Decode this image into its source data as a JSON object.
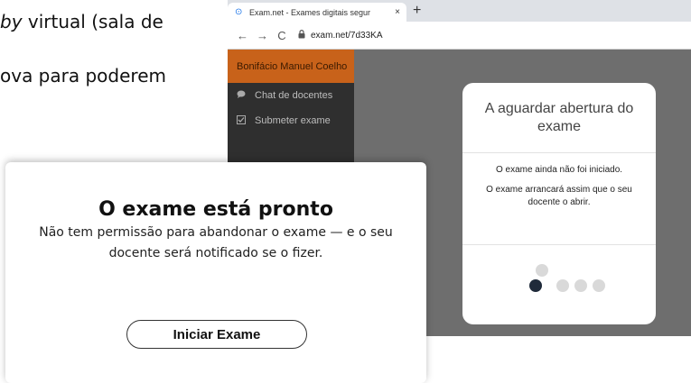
{
  "document": {
    "line1_italic": "by",
    "line1_rest": " virtual (sala de",
    "line2": "ova para poderem"
  },
  "browser": {
    "tab_title": "Exam.net - Exames digitais segur",
    "tab_close": "×",
    "new_tab": "+",
    "nav_back": "←",
    "nav_forward": "→",
    "nav_reload": "C",
    "url": "exam.net/7d33KA"
  },
  "sidebar": {
    "user_name": "Bonifácio Manuel Coelho",
    "items": [
      {
        "label": "Chat de docentes",
        "icon": "chat-icon"
      },
      {
        "label": "Submeter exame",
        "icon": "checkbox-icon"
      }
    ],
    "collapse_icon": "chevron-left-icon"
  },
  "waiting_card": {
    "title": "A aguardar abertura do exame",
    "message1": "O exame ainda não foi iniciado.",
    "message2": "O exame arrancará assim que o seu docente o abrir.",
    "dot_colors": {
      "active": "#1f2a3a",
      "inactive": "#d9d9d9"
    }
  },
  "modal": {
    "title": "O exame está pronto",
    "message": "Não tem permissão para abandonar o exame — e o seu docente será notificado se o fizer.",
    "button_label": "Iniciar Exame"
  },
  "colors": {
    "accent": "#c8621a",
    "sidebar_bg": "#2f2f2f",
    "content_bg": "#6e6e6e"
  }
}
